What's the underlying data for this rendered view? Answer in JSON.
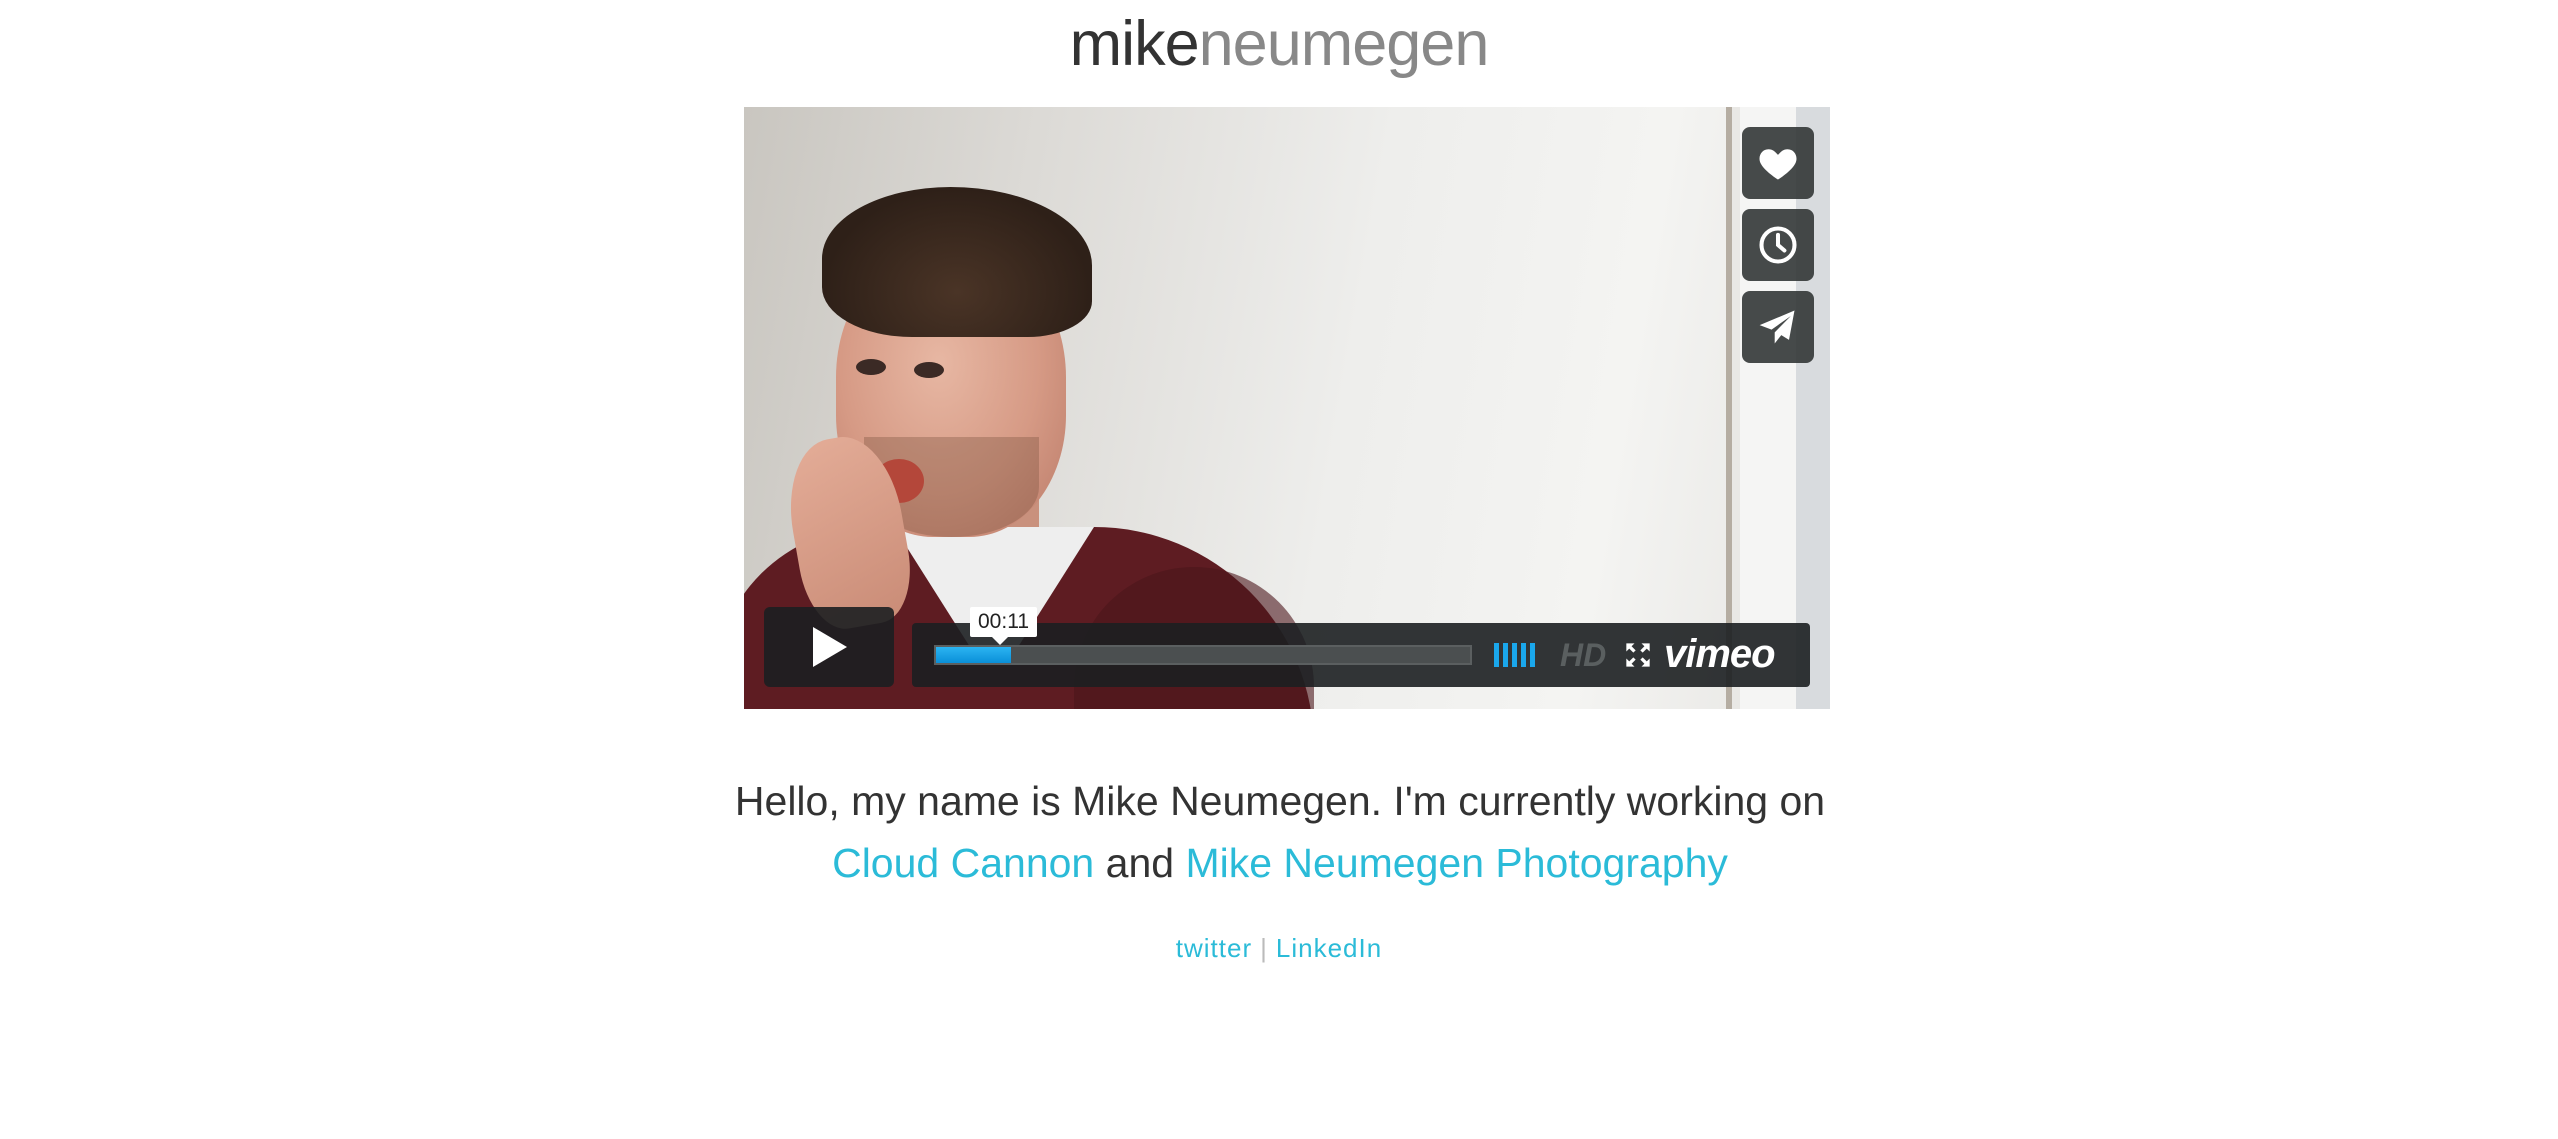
{
  "header": {
    "name_first": "mike",
    "name_last": "neumegen"
  },
  "video_player": {
    "side_buttons": [
      "heart-icon",
      "clock-icon",
      "paper-plane-icon"
    ],
    "play_icon": "play-icon",
    "time_tooltip": "00:11",
    "progress": 0.14,
    "volume_bars": 5,
    "hd_label": "HD",
    "fullscreen_icon": "fullscreen-icon",
    "brand_label": "vimeo",
    "accent_color": "#1aa7ec"
  },
  "intro": {
    "text_before": "Hello, my name is Mike Neumegen. I'm currently working on",
    "link1": "Cloud Cannon",
    "connector": "and",
    "link2": "Mike Neumegen Photography"
  },
  "social": {
    "twitter": "twitter",
    "separator": "|",
    "linkedin": "LinkedIn"
  },
  "colors": {
    "link": "#2bbbd8",
    "text": "#333333",
    "name_light": "#888888"
  }
}
